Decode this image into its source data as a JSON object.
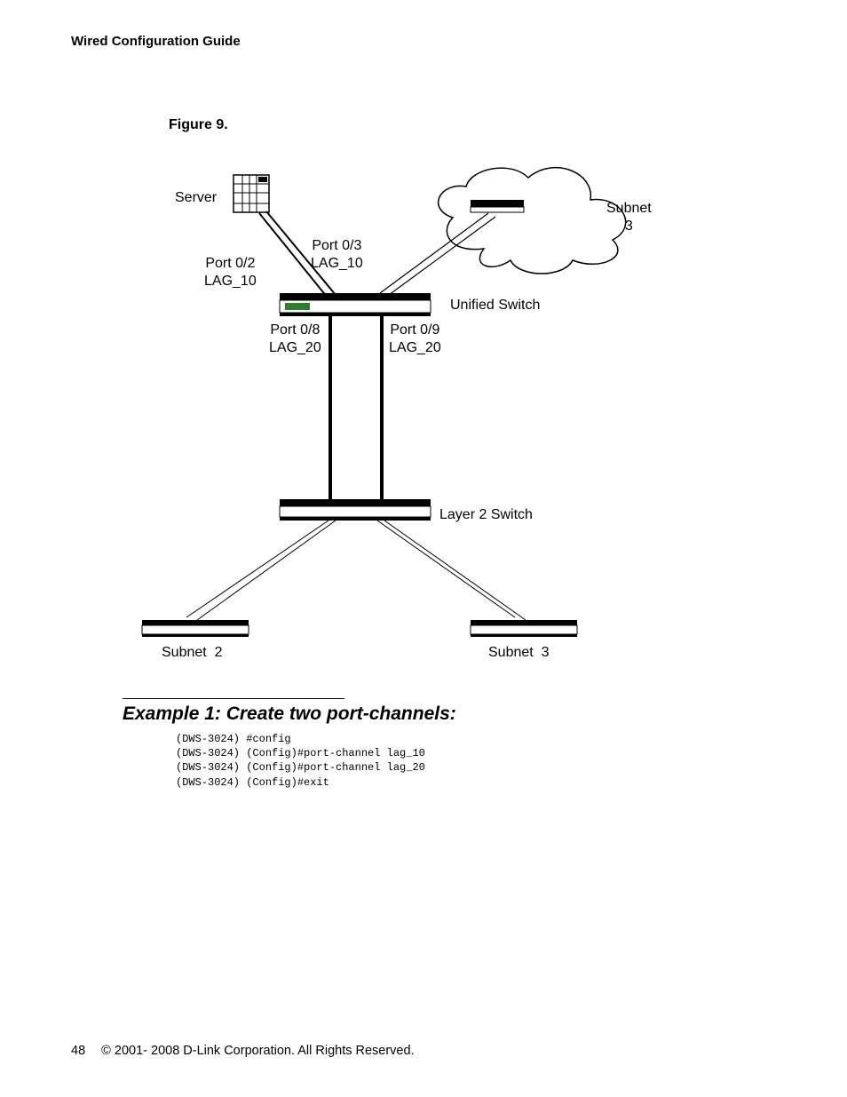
{
  "header": {
    "title": "Wired Configuration Guide"
  },
  "figure": {
    "caption": "Figure 9.",
    "labels": {
      "server": "Server",
      "subnet3_cloud": "Subnet\n3",
      "port02": "Port 0/2\nLAG_10",
      "port03": "Port 0/3\nLAG_10",
      "port08": "Port 0/8\nLAG_20",
      "port09": "Port 0/9\nLAG_20",
      "unified_switch": "Unified Switch",
      "layer2_switch": "Layer 2 Switch",
      "subnet2_bottom": "Subnet  2",
      "subnet3_bottom": "Subnet  3"
    }
  },
  "example": {
    "heading": "Example 1: Create two port-channels:",
    "code": "(DWS-3024) #config\n(DWS-3024) (Config)#port-channel lag_10\n(DWS-3024) (Config)#port-channel lag_20\n(DWS-3024) (Config)#exit"
  },
  "footer": {
    "page": "48",
    "copyright": "© 2001- 2008 D-Link Corporation. All Rights Reserved."
  },
  "chart_data": {
    "type": "diagram",
    "title": "Figure 9.",
    "nodes": [
      {
        "id": "server",
        "label": "Server",
        "kind": "server"
      },
      {
        "id": "cloud_subnet3",
        "label": "Subnet 3",
        "kind": "cloud"
      },
      {
        "id": "unified_switch",
        "label": "Unified Switch",
        "kind": "switch"
      },
      {
        "id": "layer2_switch",
        "label": "Layer 2 Switch",
        "kind": "switch"
      },
      {
        "id": "subnet2_switch",
        "label": "Subnet 2",
        "kind": "switch"
      },
      {
        "id": "subnet3_switch",
        "label": "Subnet 3",
        "kind": "switch"
      }
    ],
    "edges": [
      {
        "from": "server",
        "to": "unified_switch",
        "label": "Port 0/2 LAG_10"
      },
      {
        "from": "cloud_subnet3",
        "to": "unified_switch",
        "label": "Port 0/3 LAG_10"
      },
      {
        "from": "unified_switch",
        "to": "layer2_switch",
        "label": "Port 0/8 LAG_20"
      },
      {
        "from": "unified_switch",
        "to": "layer2_switch",
        "label": "Port 0/9 LAG_20"
      },
      {
        "from": "layer2_switch",
        "to": "subnet2_switch",
        "label": ""
      },
      {
        "from": "layer2_switch",
        "to": "subnet3_switch",
        "label": ""
      }
    ]
  }
}
